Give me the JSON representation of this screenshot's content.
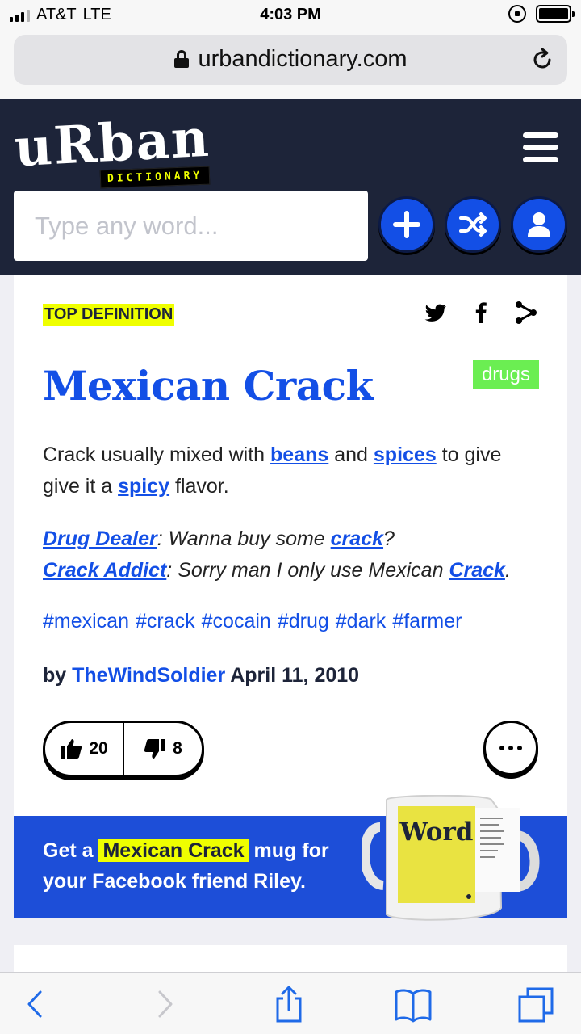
{
  "status_bar": {
    "carrier": "AT&T",
    "network": "LTE",
    "time": "4:03 PM",
    "icons": [
      "signal-icon",
      "rotation-lock-icon",
      "battery-icon"
    ]
  },
  "browser": {
    "url": "urbandictionary.com",
    "icons": [
      "lock-icon",
      "reload-icon"
    ]
  },
  "site_header": {
    "logo_word": "uRban",
    "logo_sub": "DICTIONARY",
    "search_placeholder": "Type any word...",
    "buttons": [
      "add-icon",
      "shuffle-icon",
      "user-icon"
    ]
  },
  "definition": {
    "label": "TOP DEFINITION",
    "tag": "drugs",
    "word": "Mexican Crack",
    "meaning": {
      "t1": "Crack usually mixed with ",
      "l1": "beans",
      "t2": " and ",
      "l2": "spices",
      "t3": " to give give it a ",
      "l3": "spicy",
      "t4": " flavor."
    },
    "example": {
      "s1": "Drug Dealer",
      "t1": ": Wanna buy some ",
      "l1": "crack",
      "t2": "?",
      "s2": "Crack Addict",
      "t3": ": Sorry man I only use Mexican ",
      "l2": "Crack",
      "t4": "."
    },
    "hashtags": [
      "#mexican",
      "#crack",
      "#cocain",
      "#drug",
      "#dark",
      "#farmer"
    ],
    "contributor": {
      "by": "by",
      "author": "TheWindSoldier",
      "date": "April 11, 2010"
    },
    "votes": {
      "up": "20",
      "down": "8"
    }
  },
  "mug_banner": {
    "pre": "Get a",
    "word": "Mexican Crack",
    "post": "mug for your Facebook friend Riley.",
    "mug_word": "Word"
  },
  "colors": {
    "header_bg": "#1d2439",
    "brand_blue": "#134fe6",
    "highlight_yellow": "#efff00",
    "tag_green": "#6bee52"
  }
}
